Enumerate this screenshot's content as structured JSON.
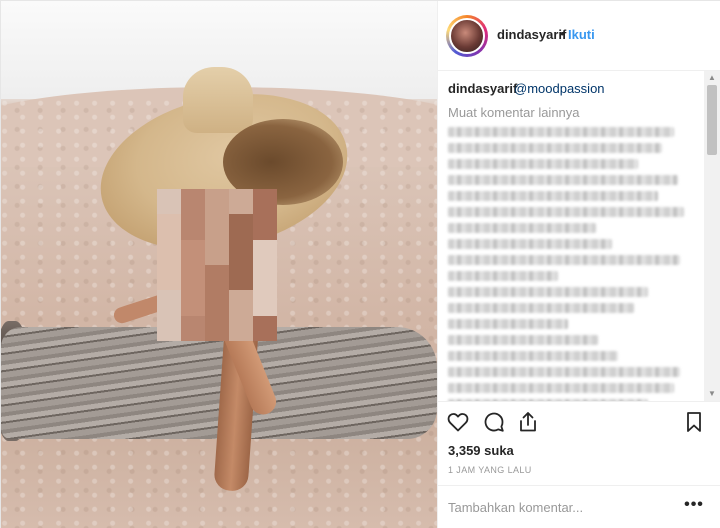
{
  "header": {
    "username": "dindasyarif",
    "separator": "•",
    "follow_label": "Ikuti"
  },
  "caption": {
    "username": "dindasyarif",
    "mention": "@moodpassion"
  },
  "comments": {
    "load_more_label": "Muat komentar lainnya"
  },
  "actions": {
    "like_icon": "heart-icon",
    "comment_icon": "comment-icon",
    "share_icon": "share-icon",
    "save_icon": "bookmark-icon"
  },
  "stats": {
    "likes_text": "3,359 suka",
    "time_text": "1 JAM YANG LALU"
  },
  "add_comment": {
    "placeholder": "Tambahkan komentar...",
    "more_label": "•••"
  },
  "colors": {
    "link_blue": "#3897f0",
    "mention_blue": "#003569",
    "muted_gray": "#999999",
    "text": "#262626"
  }
}
